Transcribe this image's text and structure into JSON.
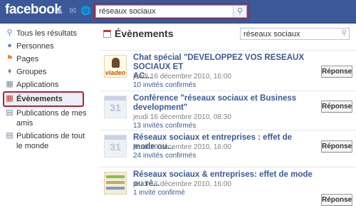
{
  "header": {
    "logo": "facebook",
    "search_value": "réseaux sociaux",
    "icons": [
      "friend-requests-icon",
      "messages-icon",
      "notifications-icon",
      "search-icon"
    ]
  },
  "sidebar": {
    "items": [
      {
        "label": "Tous les résultats",
        "icon": "magnifier-icon"
      },
      {
        "label": "Personnes",
        "icon": "person-icon"
      },
      {
        "label": "Pages",
        "icon": "page-icon"
      },
      {
        "label": "Groupes",
        "icon": "group-icon"
      },
      {
        "label": "Applications",
        "icon": "application-icon"
      },
      {
        "label": "Évènements",
        "icon": "calendar-icon",
        "active": true
      },
      {
        "label": "Publications de mes amis",
        "icon": "post-icon"
      },
      {
        "label": "Publications de tout le monde",
        "icon": "post-icon"
      }
    ]
  },
  "main": {
    "title": "Évènements",
    "search_value": "réseaux sociaux",
    "results": [
      {
        "title_line1": "Chat spécial \"DEVELOPPEZ VOS RESEAUX SOCIAUX ET",
        "title_line2": "AC...",
        "date": "jeudi 16 décembre 2010, 16:00",
        "meta": "10 invités confirmés",
        "button": "Réponse",
        "thumb": "viadeo",
        "thumb_text": "viadeo"
      },
      {
        "title_line1": "Conférence \"réseaux sociaux et Business",
        "title_line2": "development\"",
        "date": "jeudi 16 décembre 2010, 08:30",
        "meta": "13 invités confirmés",
        "button": "Réponse",
        "thumb": "calendar",
        "thumb_text": "31"
      },
      {
        "title_line1": "Réseaux sociaux et entreprises : effet de mode ou...",
        "date": "jeudi 16 décembre 2010, 16:00",
        "meta": "24 invités confirmés",
        "button": "Réponse",
        "thumb": "calendar",
        "thumb_text": "31"
      },
      {
        "title_line1": "Réseaux sociaux & entreprises: effet de mode ou ré...",
        "date": "jeudi 16 décembre 2010, 16:00",
        "meta": "1 invité confirmé",
        "button": "Réponse",
        "thumb": "photo"
      }
    ]
  },
  "colors": {
    "brand_blue": "#3b5998",
    "highlight_red": "#b0243a",
    "link_blue": "#3b5998",
    "muted_gray": "#808080"
  }
}
